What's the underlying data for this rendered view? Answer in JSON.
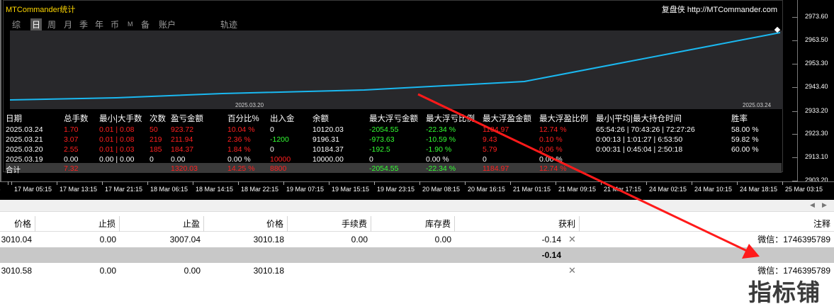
{
  "panel": {
    "title": "MTCommander统计",
    "brand": "复盘侠 http://MTCommander.com"
  },
  "tabs": [
    "综",
    "日",
    "周",
    "月",
    "季",
    "年",
    "币",
    "M",
    "备",
    "账户",
    "轨迹"
  ],
  "active_tab": "日",
  "plot_dates": {
    "start": "2025.03.20",
    "end": "2025.03.24"
  },
  "stats": {
    "headers": [
      "日期",
      "总手数",
      "最小|大手数",
      "次数",
      "盈亏金额",
      "百分比%",
      "出入金",
      "余额",
      "最大浮亏金额",
      "最大浮亏比例",
      "最大浮盈金额",
      "最大浮盈比例",
      "最小|平均|最大持仓时间",
      "胜率"
    ],
    "rows": [
      [
        "2025.03.24",
        "1.70",
        "0.01 | 0.08",
        "50",
        "923.72",
        "10.04 %",
        "0",
        "10120.03",
        "-2054.55",
        "-22.34 %",
        "1184.97",
        "12.74 %",
        "65:54:26 | 70:43:26 | 72:27:26",
        "58.00 %"
      ],
      [
        "2025.03.21",
        "3.07",
        "0.01 | 0.08",
        "219",
        "211.94",
        "2.36 %",
        "-1200",
        "9196.31",
        "-973.63",
        "-10.59 %",
        "9.43",
        "0.10 %",
        "0:00:13 | 1:01:27 | 6:53:50",
        "59.82 %"
      ],
      [
        "2025.03.20",
        "2.55",
        "0.01 | 0.03",
        "185",
        "184.37",
        "1.84 %",
        "0",
        "10184.37",
        "-192.5",
        "-1.90 %",
        "5.79",
        "0.06 %",
        "0:00:31 | 0:45:04 | 2:50:18",
        "60.00 %"
      ],
      [
        "2025.03.19",
        "0.00",
        "0.00 | 0.00",
        "0",
        "0.00",
        "0.00 %",
        "10000",
        "10000.00",
        "0",
        "0.00 %",
        "0",
        "0.00 %",
        "",
        ""
      ]
    ],
    "total": {
      "label": "合计",
      "lots": "7.32",
      "pnl": "1320.03",
      "pct": "14.25 %",
      "deposit": "8800",
      "max_float_loss": "-2054.55",
      "max_float_loss_pct": "-22.34 %",
      "max_float_profit": "1184.97",
      "max_float_profit_pct": "12.74 %"
    }
  },
  "y_axis": [
    "2973.60",
    "2963.50",
    "2953.30",
    "2943.40",
    "2933.20",
    "2923.30",
    "2913.10",
    "2903.20"
  ],
  "x_axis": [
    "17 Mar 2015",
    "17 Mar 05:15",
    "17 Mar 13:15",
    "17 Mar 21:15",
    "18 Mar 06:15",
    "18 Mar 14:15",
    "18 Mar 22:15",
    "19 Mar 07:15",
    "19 Mar 15:15",
    "19 Mar 23:15",
    "20 Mar 08:15",
    "20 Mar 16:15",
    "21 Mar 01:15",
    "21 Mar 09:15",
    "21 Mar 17:15",
    "24 Mar 02:15",
    "24 Mar 10:15",
    "24 Mar 18:15",
    "25 Mar 03:15"
  ],
  "trade_table": {
    "headers": [
      "价格",
      "止损",
      "止盈",
      "价格",
      "手续费",
      "库存费",
      "获利",
      "注释"
    ],
    "rows": [
      {
        "price_open": "3010.04",
        "sl": "0.00",
        "tp": "3007.04",
        "price_current": "3010.18",
        "commission": "0.00",
        "swap": "0.00",
        "profit": "-0.14",
        "comment": "微信：1746395789"
      },
      {
        "price_open": "3010.58",
        "sl": "0.00",
        "tp": "0.00",
        "price_current": "3010.18",
        "commission": "",
        "swap": "",
        "profit": "",
        "comment": "微信：1746395789"
      }
    ],
    "summary_profit": "-0.14"
  },
  "watermark": "指标铺",
  "colors": {
    "equity_line": "#1ab8f0",
    "annotation_arrow": "#ff1a1a",
    "negative": "#ff2020",
    "positive": "#33ff33",
    "title": "#ffd700"
  }
}
